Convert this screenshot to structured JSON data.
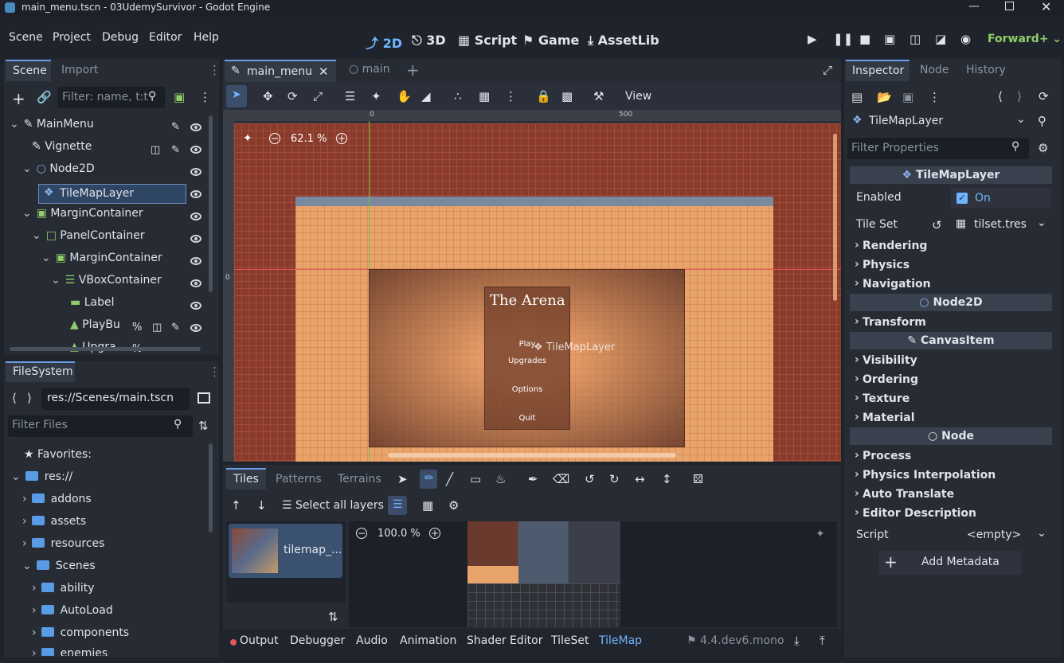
{
  "window": {
    "title": "main_menu.tscn - 03UdemySurvivor - Godot Engine"
  },
  "menu": {
    "items": [
      "Scene",
      "Project",
      "Debug",
      "Editor",
      "Help"
    ]
  },
  "workspaces": {
    "d2": "2D",
    "d3": "3D",
    "script": "Script",
    "game": "Game",
    "assetlib": "AssetLib"
  },
  "renderer": "Forward+",
  "scene_dock": {
    "tabs": [
      "Scene",
      "Import"
    ],
    "filter_placeholder": "Filter: name, t:t",
    "nodes": [
      {
        "label": "MainMenu",
        "depth": 0
      },
      {
        "label": "Vignette",
        "depth": 1
      },
      {
        "label": "Node2D",
        "depth": 1
      },
      {
        "label": "TileMapLayer",
        "depth": 2
      },
      {
        "label": "MarginContainer",
        "depth": 1
      },
      {
        "label": "PanelContainer",
        "depth": 2
      },
      {
        "label": "MarginContainer",
        "depth": 3
      },
      {
        "label": "VBoxContainer",
        "depth": 4
      },
      {
        "label": "Label",
        "depth": 5
      },
      {
        "label": "PlayBu",
        "depth": 5
      },
      {
        "label": "Upgra",
        "depth": 5
      }
    ]
  },
  "filesystem": {
    "title": "FileSystem",
    "path": "res://Scenes/main.tscn",
    "filter_placeholder": "Filter Files",
    "favorites": "Favorites:",
    "root": "res://",
    "items": [
      "addons",
      "assets",
      "resources",
      "Scenes",
      "ability",
      "AutoLoad",
      "components",
      "enemies"
    ]
  },
  "editor_tabs": {
    "main_menu": "main_menu",
    "main": "main"
  },
  "toolbar": {
    "view": "View"
  },
  "viewport": {
    "zoom": "62.1 %",
    "ruler0": "0",
    "ruler500": "500",
    "game_title": "The Arena",
    "buttons": [
      "Play",
      "Upgrades",
      "Options",
      "Quit"
    ],
    "hover_label": "TileMapLayer",
    "colors": {
      "bg": "#8a3a2a",
      "sand": "#e9a46c"
    }
  },
  "tilemap_panel": {
    "tabs": [
      "Tiles",
      "Patterns",
      "Terrains"
    ],
    "select_layers": "Select all layers",
    "zoom": "100.0 %",
    "tileset_item": "tilemap_..."
  },
  "bottom_tabs": [
    "Output",
    "Debugger",
    "Audio",
    "Animation",
    "Shader Editor",
    "TileSet",
    "TileMap"
  ],
  "version": "4.4.dev6.mono",
  "inspector": {
    "tabs": [
      "Inspector",
      "Node",
      "History"
    ],
    "object": "TileMapLayer",
    "filter_placeholder": "Filter Properties",
    "class_tilemaplayer": "TileMapLayer",
    "enabled_label": "Enabled",
    "enabled_value": "On",
    "tileset_label": "Tile Set",
    "tileset_value": "tilset.tres",
    "groups1": [
      "Rendering",
      "Physics",
      "Navigation"
    ],
    "class_node2d": "Node2D",
    "groups2": [
      "Transform"
    ],
    "class_canvasitem": "CanvasItem",
    "groups3": [
      "Visibility",
      "Ordering",
      "Texture",
      "Material"
    ],
    "class_node": "Node",
    "groups4": [
      "Process",
      "Physics Interpolation",
      "Auto Translate",
      "Editor Description"
    ],
    "script_label": "Script",
    "script_value": "<empty>",
    "add_metadata": "Add Metadata"
  }
}
